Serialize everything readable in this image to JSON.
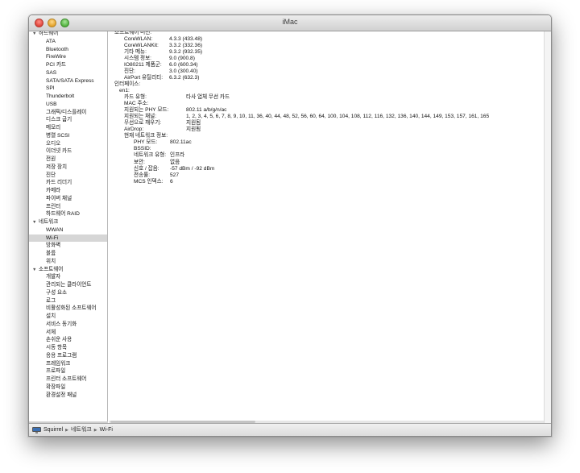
{
  "window": {
    "title": "iMac"
  },
  "sidebar": {
    "sections": [
      {
        "label": "하드웨어",
        "items": [
          "ATA",
          "Bluetooth",
          "FireWire",
          "PCI 카드",
          "SAS",
          "SATA/SATA Express",
          "SPI",
          "Thunderbolt",
          "USB",
          "그래픽/디스플레이",
          "디스크 굽기",
          "메모리",
          "병렬 SCSI",
          "오디오",
          "이더넷 카드",
          "전원",
          "저장 장치",
          "진단",
          "카드 리더기",
          "카메라",
          "파이버 채널",
          "프린터",
          "하드웨어 RAID"
        ]
      },
      {
        "label": "네트워크",
        "items": [
          "WWAN",
          "Wi-Fi",
          "방화벽",
          "볼륨",
          "위치"
        ],
        "selected_item": "Wi-Fi"
      },
      {
        "label": "소프트웨어",
        "items": [
          "개발자",
          "관리되는 클라이언트",
          "구성 요소",
          "로그",
          "비활성화된 소프트웨어",
          "설치",
          "서비스 동기화",
          "서체",
          "손쉬운 사용",
          "시동 항목",
          "응용 프로그램",
          "프레임워크",
          "프로파일",
          "프린터 소프트웨어",
          "확장파일",
          "환경설정 패널"
        ]
      }
    ]
  },
  "main": {
    "software_versions_header": "소프트웨어 버전:",
    "software_versions": [
      {
        "label": "CoreWLAN:",
        "value": "4.3.3 (433.48)"
      },
      {
        "label": "CoreWLANKit:",
        "value": "3.3.2 (332.36)"
      },
      {
        "label": "기타 메뉴:",
        "value": "9.3.2 (932.35)"
      },
      {
        "label": "시스템 정보:",
        "value": "9.0 (900.8)"
      },
      {
        "label": "IO80211 제품군:",
        "value": "6.0 (600.34)"
      },
      {
        "label": "진단:",
        "value": "3.0 (300.40)"
      },
      {
        "label": "AirPort 유틸리티:",
        "value": "6.3.2 (632.3)"
      }
    ],
    "interfaces_header": "인터페이스:",
    "interface_name": "en1:",
    "interface_fields": [
      {
        "label": "카드 유형:",
        "value": "타사 업체 무선 카드"
      },
      {
        "label": "MAC 주소:",
        "value": ""
      },
      {
        "label": "지원되는 PHY 모드:",
        "value": "802.11 a/b/g/n/ac"
      },
      {
        "label": "지원되는 채널:",
        "value": "1, 2, 3, 4, 5, 6, 7, 8, 9, 10, 11, 36, 40, 44, 48, 52, 56, 60, 64, 100, 104, 108, 112, 116, 132, 136, 140, 144, 149, 153, 157, 161, 165"
      },
      {
        "label": "무선으로 깨우기:",
        "value": "지원됨"
      },
      {
        "label": "AirDrop:",
        "value": "지원됨"
      }
    ],
    "current_network_header": "현재 네트워크 정보:",
    "current_network_fields": [
      {
        "label": "PHY 모드:",
        "value": "802.11ac"
      },
      {
        "label": "BSSID:",
        "value": ""
      },
      {
        "label": "네트워크 유형:",
        "value": "인프라"
      },
      {
        "label": "보안:",
        "value": "없음"
      },
      {
        "label": "신호 / 잡음:",
        "value": "-57 dBm / -92 dBm"
      },
      {
        "label": "전송률:",
        "value": "527"
      },
      {
        "label": "MCS 인덱스:",
        "value": "6"
      }
    ]
  },
  "statusbar": {
    "crumbs": [
      "Squirrel",
      "네트워크",
      "Wi-Fi"
    ]
  }
}
